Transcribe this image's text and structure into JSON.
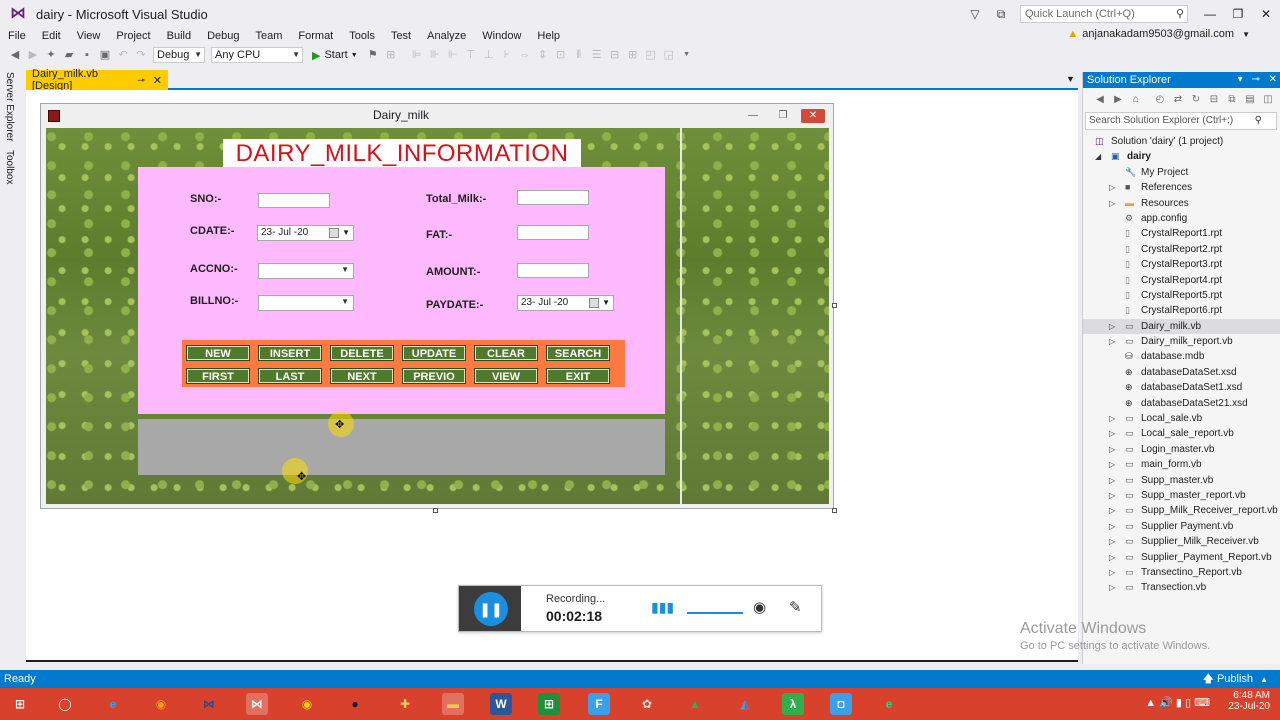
{
  "window": {
    "title": "dairy - Microsoft Visual Studio",
    "quick_launch_placeholder": "Quick Launch (Ctrl+Q)",
    "account": "anjanakadam9503@gmail.com"
  },
  "menu": [
    "File",
    "Edit",
    "View",
    "Project",
    "Build",
    "Debug",
    "Team",
    "Format",
    "Tools",
    "Test",
    "Analyze",
    "Window",
    "Help"
  ],
  "toolbar": {
    "config": "Debug",
    "platform": "Any CPU",
    "start_label": "Start"
  },
  "side_tabs": [
    "Server Explorer",
    "Toolbox"
  ],
  "document_tab": {
    "label": "Dairy_milk.vb [Design]"
  },
  "form": {
    "title": "Dairy_milk",
    "banner": "DAIRY_MILK_INFORMATION",
    "labels": {
      "sno": "SNO:-",
      "cdate": "CDATE:-",
      "accno": "ACCNO:-",
      "billno": "BILLNO:-",
      "total_milk": "Total_Milk:-",
      "fat": "FAT:-",
      "amount": "AMOUNT:-",
      "paydate": "PAYDATE:-"
    },
    "cdate_value": "23- Jul -20",
    "paydate_value": "23- Jul -20",
    "buttons_row1": [
      "NEW",
      "INSERT",
      "DELETE",
      "UPDATE",
      "CLEAR",
      "SEARCH"
    ],
    "buttons_row2": [
      "FIRST",
      "LAST",
      "NEXT",
      "PREVIO",
      "VIEW",
      "EXIT"
    ]
  },
  "recorder": {
    "status": "Recording...",
    "time": "00:02:18"
  },
  "solution_explorer": {
    "title": "Solution Explorer",
    "search_placeholder": "Search Solution Explorer (Ctrl+;)",
    "items": [
      {
        "label": "Solution 'dairy' (1 project)",
        "level": 0,
        "expander": "",
        "icon": "solution-icon"
      },
      {
        "label": "dairy",
        "level": 1,
        "expander": "◢",
        "icon": "vb-project-icon",
        "bold": true
      },
      {
        "label": "My Project",
        "level": 2,
        "expander": "",
        "icon": "wrench-icon"
      },
      {
        "label": "References",
        "level": 2,
        "expander": "▷",
        "icon": "references-icon"
      },
      {
        "label": "Resources",
        "level": 2,
        "expander": "▷",
        "icon": "folder-icon"
      },
      {
        "label": "app.config",
        "level": 2,
        "expander": "",
        "icon": "config-icon"
      },
      {
        "label": "CrystalReport1.rpt",
        "level": 2,
        "expander": "",
        "icon": "file-icon"
      },
      {
        "label": "CrystalReport2.rpt",
        "level": 2,
        "expander": "",
        "icon": "file-icon"
      },
      {
        "label": "CrystalReport3.rpt",
        "level": 2,
        "expander": "",
        "icon": "file-icon"
      },
      {
        "label": "CrystalReport4.rpt",
        "level": 2,
        "expander": "",
        "icon": "file-icon"
      },
      {
        "label": "CrystalReport5.rpt",
        "level": 2,
        "expander": "",
        "icon": "file-icon"
      },
      {
        "label": "CrystalReport6.rpt",
        "level": 2,
        "expander": "",
        "icon": "file-icon"
      },
      {
        "label": "Dairy_milk.vb",
        "level": 2,
        "expander": "▷",
        "icon": "form-icon",
        "selected": true
      },
      {
        "label": "Dairy_milk_report.vb",
        "level": 2,
        "expander": "▷",
        "icon": "form-icon"
      },
      {
        "label": "database.mdb",
        "level": 2,
        "expander": "",
        "icon": "database-icon"
      },
      {
        "label": "databaseDataSet.xsd",
        "level": 2,
        "expander": "",
        "icon": "dataset-icon"
      },
      {
        "label": "databaseDataSet1.xsd",
        "level": 2,
        "expander": "",
        "icon": "dataset-icon"
      },
      {
        "label": "databaseDataSet21.xsd",
        "level": 2,
        "expander": "",
        "icon": "dataset-icon"
      },
      {
        "label": "Local_sale.vb",
        "level": 2,
        "expander": "▷",
        "icon": "form-icon"
      },
      {
        "label": "Local_sale_report.vb",
        "level": 2,
        "expander": "▷",
        "icon": "form-icon"
      },
      {
        "label": "Login_master.vb",
        "level": 2,
        "expander": "▷",
        "icon": "form-icon"
      },
      {
        "label": "main_form.vb",
        "level": 2,
        "expander": "▷",
        "icon": "form-icon"
      },
      {
        "label": "Supp_master.vb",
        "level": 2,
        "expander": "▷",
        "icon": "form-icon"
      },
      {
        "label": "Supp_master_report.vb",
        "level": 2,
        "expander": "▷",
        "icon": "form-icon"
      },
      {
        "label": "Supp_Milk_Receiver_report.vb",
        "level": 2,
        "expander": "▷",
        "icon": "form-icon"
      },
      {
        "label": "Supplier Payment.vb",
        "level": 2,
        "expander": "▷",
        "icon": "form-icon"
      },
      {
        "label": "Supplier_Milk_Receiver.vb",
        "level": 2,
        "expander": "▷",
        "icon": "form-icon"
      },
      {
        "label": "Supplier_Payment_Report.vb",
        "level": 2,
        "expander": "▷",
        "icon": "form-icon"
      },
      {
        "label": "Transectino_Report.vb",
        "level": 2,
        "expander": "▷",
        "icon": "form-icon"
      },
      {
        "label": "Transection.vb",
        "level": 2,
        "expander": "▷",
        "icon": "form-icon"
      }
    ]
  },
  "watermark": {
    "line1": "Activate Windows",
    "line2": "Go to PC settings to activate Windows."
  },
  "status": {
    "left": "Ready",
    "publish": "Publish"
  },
  "taskbar": {
    "time": "6:48 AM",
    "date": "23-Jul-20"
  },
  "colors": {
    "accent": "#007acc",
    "banner_text": "#d8101a",
    "panel_pink": "#ffb9ff",
    "button_panel": "#ff7a40",
    "button_green": "#4f7a2e",
    "taskbar": "#d8412c",
    "doc_tab": "#ffcc00"
  }
}
